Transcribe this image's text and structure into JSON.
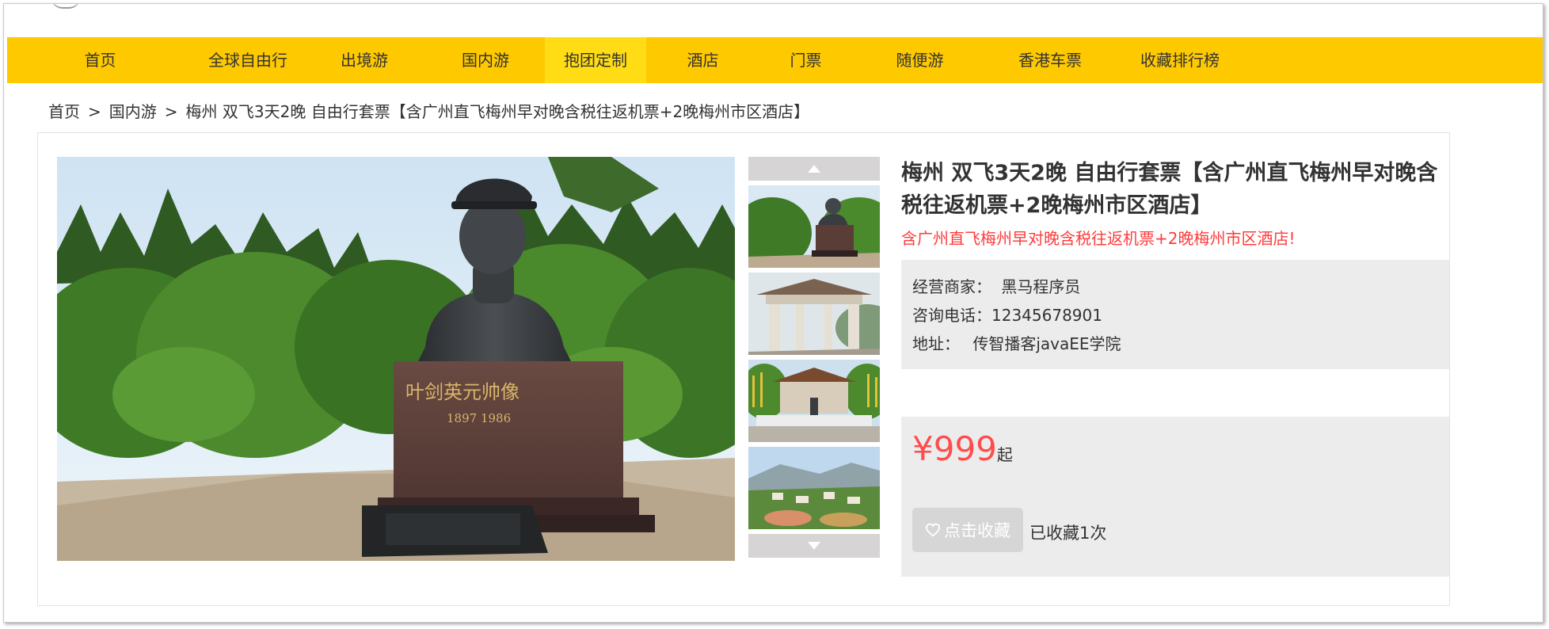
{
  "nav": {
    "items": [
      {
        "label": "首页",
        "width": 235
      },
      {
        "label": "全球自由行",
        "width": 138
      },
      {
        "label": "出境游",
        "width": 156
      },
      {
        "label": "国内游",
        "width": 150
      },
      {
        "label": "抱团定制",
        "width": 128,
        "active": true
      },
      {
        "label": "酒店",
        "width": 143
      },
      {
        "label": "门票",
        "width": 117
      },
      {
        "label": "随便游",
        "width": 171
      },
      {
        "label": "香港车票",
        "width": 158
      },
      {
        "label": "收藏排行榜",
        "width": 170
      }
    ]
  },
  "breadcrumb": {
    "home": "首页",
    "separator": ">",
    "category": "国内游",
    "current": "梅州 双飞3天2晚 自由行套票【含广州直飞梅州早对晚含税往返机票+2晚梅州市区酒店】"
  },
  "product": {
    "title": "梅州 双飞3天2晚 自由行套票【含广州直飞梅州早对晚含税往返机票+2晚梅州市区酒店】",
    "subtitle": "含广州直飞梅州早对晚含税往返机票+2晚梅州市区酒店!",
    "merchant_label": "经营商家：",
    "merchant_value": "黑马程序员",
    "phone_label": "咨询电话：",
    "phone_value": "12345678901",
    "address_label": "地址：",
    "address_value": "传智播客javaEE学院",
    "price": "¥999",
    "price_suffix": "起",
    "favorite_button": "点击收藏",
    "favorite_count_text": "已收藏1次",
    "statue_inscription": "叶剑英元帅像",
    "statue_years": "1897   1986"
  },
  "colors": {
    "nav_bg": "#ffc900",
    "nav_active_bg": "#ffdc14",
    "price": "#ff4c4c",
    "subtitle": "#ff3b3b",
    "info_bg": "#ececec"
  }
}
